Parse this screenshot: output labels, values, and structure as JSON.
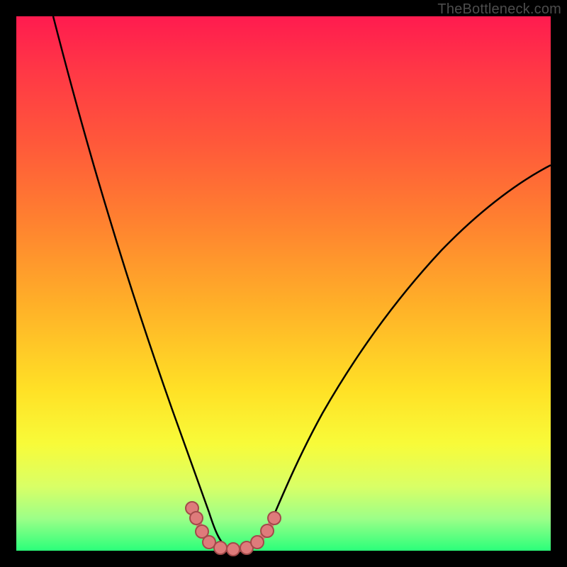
{
  "watermark": "TheBottleneck.com",
  "colors": {
    "frame": "#000000",
    "curve": "#000000",
    "node_fill": "#de7b7b",
    "node_stroke": "#a34a4a",
    "gradient_top": "#ff1b4f",
    "gradient_bottom": "#2bff7a"
  },
  "chart_data": {
    "type": "line",
    "title": "",
    "xlabel": "",
    "ylabel": "",
    "xlim": [
      0,
      100
    ],
    "ylim": [
      0,
      100
    ],
    "grid": false,
    "legend": false,
    "background_gradient": [
      "#ff1b4f",
      "#ff593a",
      "#ffb028",
      "#ffe126",
      "#f8fb39",
      "#2bff7a"
    ],
    "series": [
      {
        "name": "left-descent",
        "x": [
          7,
          10,
          14,
          18,
          22,
          25,
          27,
          29,
          31,
          33,
          35,
          36.5
        ],
        "y": [
          100,
          86,
          70,
          55,
          40,
          28,
          21,
          15,
          10,
          6,
          3,
          1
        ]
      },
      {
        "name": "valley-floor",
        "x": [
          36.5,
          38,
          40,
          42,
          44,
          45.5
        ],
        "y": [
          1,
          0.3,
          0.2,
          0.2,
          0.3,
          1
        ]
      },
      {
        "name": "right-ascent",
        "x": [
          45.5,
          48,
          51,
          55,
          60,
          66,
          73,
          81,
          90,
          100
        ],
        "y": [
          1,
          3,
          7,
          13,
          21,
          31,
          42,
          53,
          63,
          72
        ]
      }
    ],
    "markers": {
      "name": "valley-cluster",
      "points": [
        {
          "x": 32.7,
          "y": 7.5
        },
        {
          "x": 33.6,
          "y": 5.5
        },
        {
          "x": 34.8,
          "y": 3.0
        },
        {
          "x": 36.0,
          "y": 1.4
        },
        {
          "x": 38.0,
          "y": 0.5
        },
        {
          "x": 40.5,
          "y": 0.3
        },
        {
          "x": 43.0,
          "y": 0.5
        },
        {
          "x": 45.0,
          "y": 1.5
        },
        {
          "x": 46.8,
          "y": 3.5
        },
        {
          "x": 48.2,
          "y": 6.0
        }
      ]
    }
  }
}
